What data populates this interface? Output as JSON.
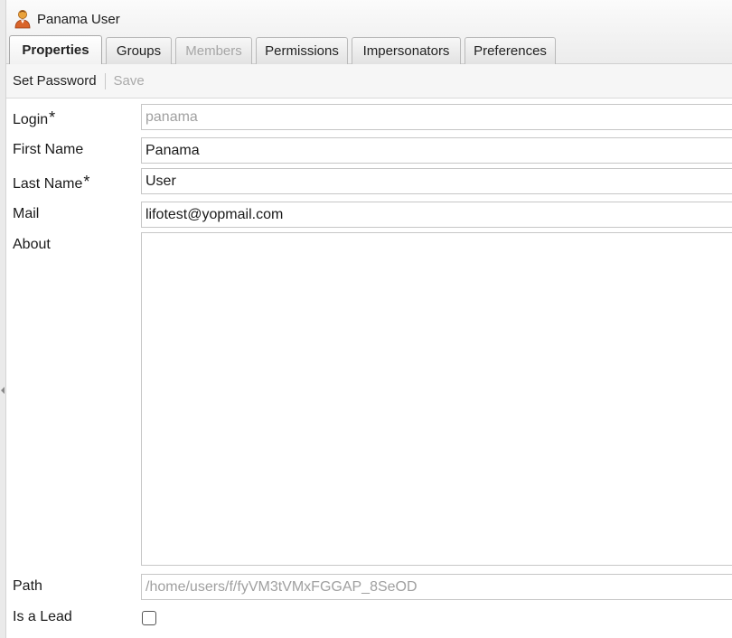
{
  "window": {
    "title": "Panama User",
    "icon": "user-icon"
  },
  "tabs": [
    {
      "label": "Properties",
      "active": true,
      "disabled": false
    },
    {
      "label": "Groups",
      "active": false,
      "disabled": false
    },
    {
      "label": "Members",
      "active": false,
      "disabled": true
    },
    {
      "label": "Permissions",
      "active": false,
      "disabled": false
    },
    {
      "label": "Impersonators",
      "active": false,
      "disabled": false
    },
    {
      "label": "Preferences",
      "active": false,
      "disabled": false
    }
  ],
  "toolbar": {
    "set_password_label": "Set Password",
    "save_label": "Save"
  },
  "form": {
    "required_marker": "*",
    "login": {
      "label": "Login",
      "value": "panama"
    },
    "first_name": {
      "label": "First Name",
      "value": "Panama"
    },
    "last_name": {
      "label": "Last Name",
      "value": "User"
    },
    "mail": {
      "label": "Mail",
      "value": "lifotest@yopmail.com"
    },
    "about": {
      "label": "About",
      "value": ""
    },
    "path": {
      "label": "Path",
      "value": "/home/users/f/fyVM3tVMxFGGAP_8SeOD"
    },
    "is_lead": {
      "label": "Is a Lead",
      "checked": false
    }
  },
  "colors": {
    "header_bg": "#ececec",
    "disabled_text": "#a6a6a6",
    "border": "#c6c6c6"
  }
}
